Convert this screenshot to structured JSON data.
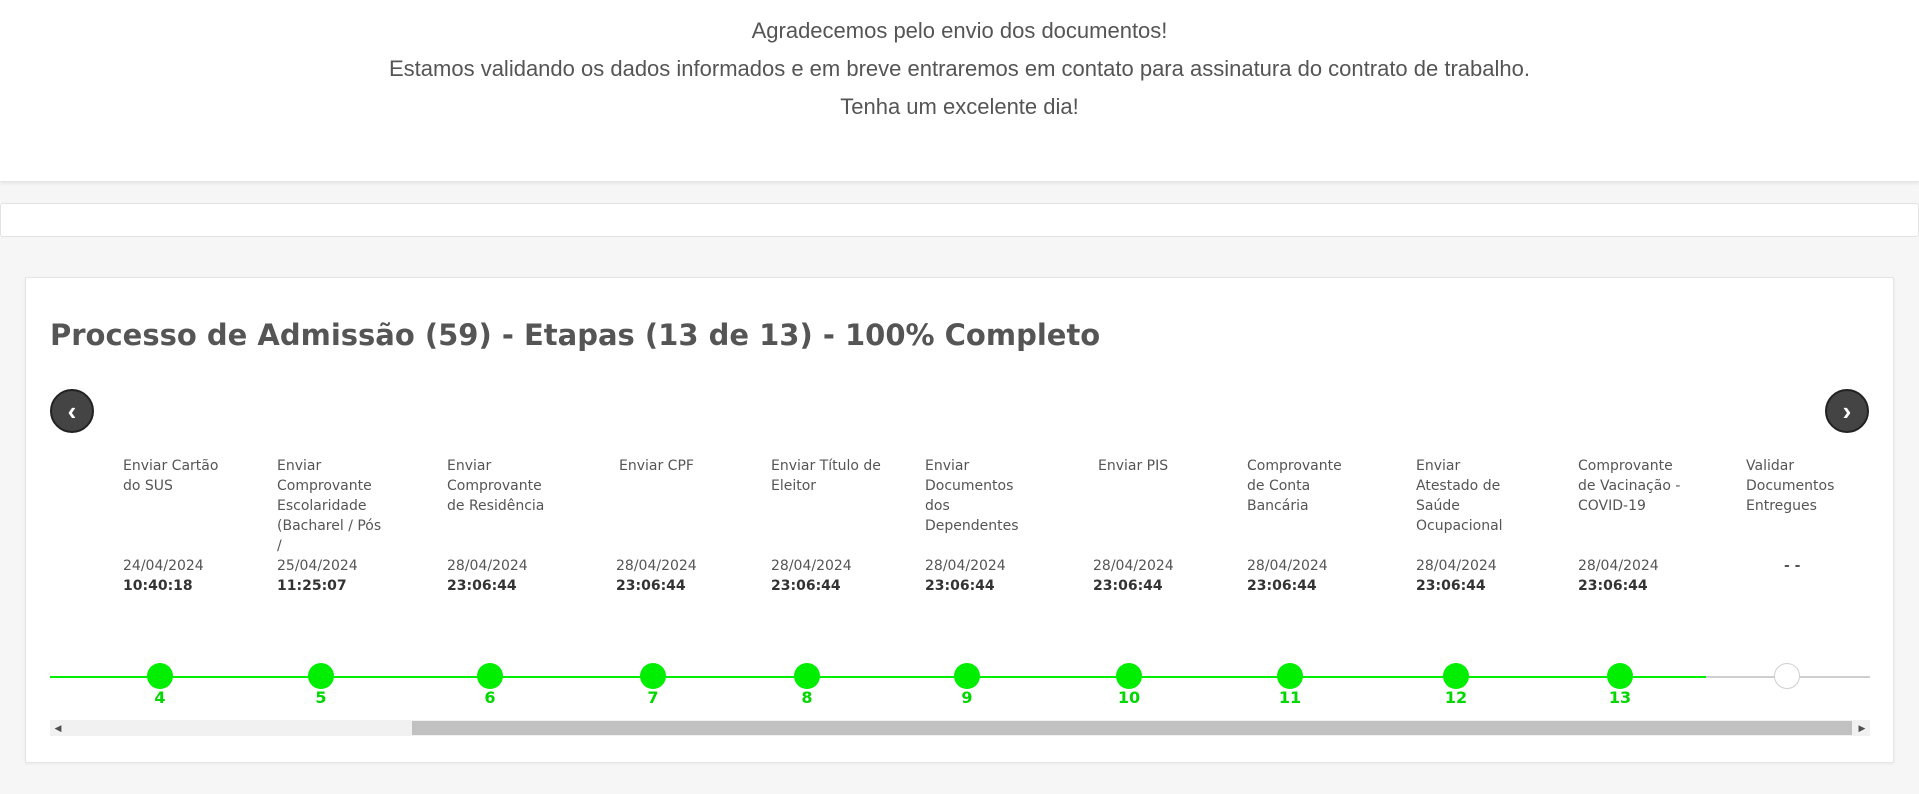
{
  "message": {
    "line1": "Agradecemos pelo envio dos documentos!",
    "line2": "Estamos validando os dados informados e em breve entraremos em contato para assinatura do contrato de trabalho.",
    "line3": "Tenha um excelente dia!"
  },
  "process": {
    "title": "Processo de Admissão (59) - Etapas (13 de 13) - 100% Completo"
  },
  "carousel": {
    "prev_glyph": "‹",
    "next_glyph": "›"
  },
  "steps": [
    {
      "label": "Enviar Cartão do SUS",
      "date": "24/04/2024",
      "time": "10:40:18",
      "number": "4",
      "done": true
    },
    {
      "label": "Enviar Comprovante Escolaridade (Bacharel / Pós /",
      "date": "25/04/2024",
      "time": "11:25:07",
      "number": "5",
      "done": true
    },
    {
      "label": "Enviar Comprovante de Residência",
      "date": "28/04/2024",
      "time": "23:06:44",
      "number": "6",
      "done": true
    },
    {
      "label": "Enviar CPF",
      "date": "28/04/2024",
      "time": "23:06:44",
      "number": "7",
      "done": true
    },
    {
      "label": "Enviar Título de Eleitor",
      "date": "28/04/2024",
      "time": "23:06:44",
      "number": "8",
      "done": true
    },
    {
      "label": "Enviar Documentos dos Dependentes",
      "date": "28/04/2024",
      "time": "23:06:44",
      "number": "9",
      "done": true
    },
    {
      "label": "Enviar PIS",
      "date": "28/04/2024",
      "time": "23:06:44",
      "number": "10",
      "done": true
    },
    {
      "label": "Comprovante de Conta Bancária",
      "date": "28/04/2024",
      "time": "23:06:44",
      "number": "11",
      "done": true
    },
    {
      "label": "Enviar Atestado de Saúde Ocupacional",
      "date": "28/04/2024",
      "time": "23:06:44",
      "number": "12",
      "done": true
    },
    {
      "label": "Comprovante de Vacinação - COVID-19",
      "date": "28/04/2024",
      "time": "23:06:44",
      "number": "13",
      "done": true
    },
    {
      "label": "Validar Documentos Entregues",
      "date": "- -",
      "time": "",
      "number": "",
      "done": false
    }
  ],
  "colors": {
    "done": "#00ee00",
    "pending": "#cfcfcf"
  }
}
